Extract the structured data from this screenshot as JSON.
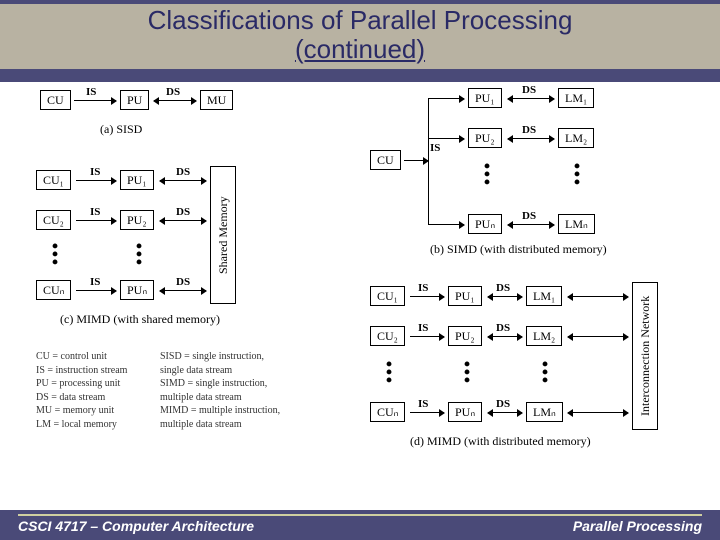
{
  "title_line1": "Classifications of Parallel Processing",
  "title_line2": "(continued)",
  "footer_left": "CSCI 4717 – Computer Architecture",
  "footer_right": "Parallel Processing",
  "blocks": {
    "CU": "CU",
    "CU1": "CU₁",
    "CU2": "CU₂",
    "CUn": "CUₙ",
    "PU": "PU",
    "PU1": "PU₁",
    "PU2": "PU₂",
    "PUn": "PUₙ",
    "MU": "MU",
    "LM1": "LM₁",
    "LM2": "LM₂",
    "LMn": "LMₙ",
    "SharedMemory": "Shared Memory",
    "IntNet": "Interconnection Network"
  },
  "labels": {
    "IS": "IS",
    "DS": "DS"
  },
  "captions": {
    "a": "(a) SISD",
    "b": "(b) SIMD (with distributed memory)",
    "c": "(c) MIMD (with shared memory)",
    "d": "(d) MIMD (with distributed memory)"
  },
  "legend_left": [
    "CU = control unit",
    "IS = instruction stream",
    "PU = processing unit",
    "DS = data stream",
    "MU = memory unit",
    "LM = local memory"
  ],
  "legend_right": [
    "SISD =  single instruction,",
    "             single data stream",
    "SIMD =  single instruction,",
    "             multiple data stream",
    "MIMD =  multiple instruction,",
    "             multiple data stream"
  ]
}
